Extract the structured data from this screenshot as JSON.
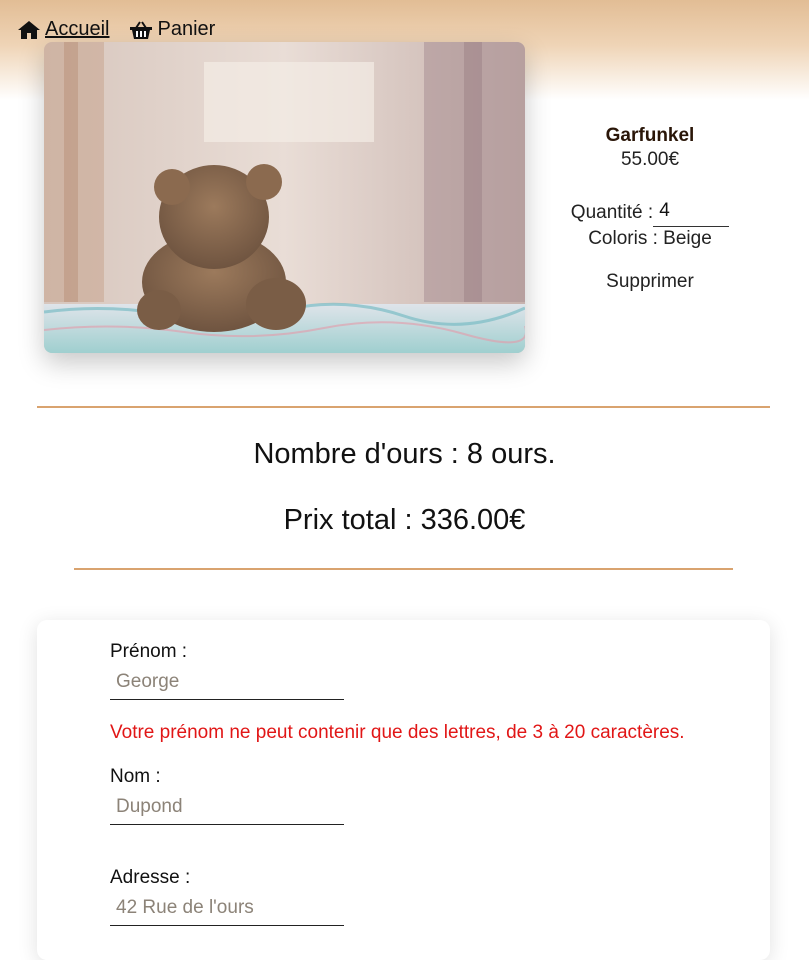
{
  "nav": {
    "home_label": "Accueil",
    "cart_label": "Panier",
    "home_icon": "house-icon",
    "cart_icon": "basket-icon"
  },
  "product": {
    "name": "Garfunkel",
    "price": "55.00€",
    "quantity_label": "Quantité :",
    "quantity_value": "4",
    "color_label": "Coloris :",
    "color_value": "Beige",
    "remove_label": "Supprimer"
  },
  "summary": {
    "count_text": "Nombre d'ours : 8 ours.",
    "total_text": "Prix total : 336.00€"
  },
  "form": {
    "firstname_label": "Prénom :",
    "firstname_placeholder": "George",
    "firstname_error": "Votre prénom ne peut contenir que des lettres, de 3 à 20 caractères.",
    "lastname_label": "Nom :",
    "lastname_placeholder": "Dupond",
    "address_label": "Adresse :",
    "address_placeholder": "42 Rue de l'ours"
  },
  "colors": {
    "accent": "#d9a36f",
    "header": "#e2bd95",
    "error": "#e11616"
  }
}
